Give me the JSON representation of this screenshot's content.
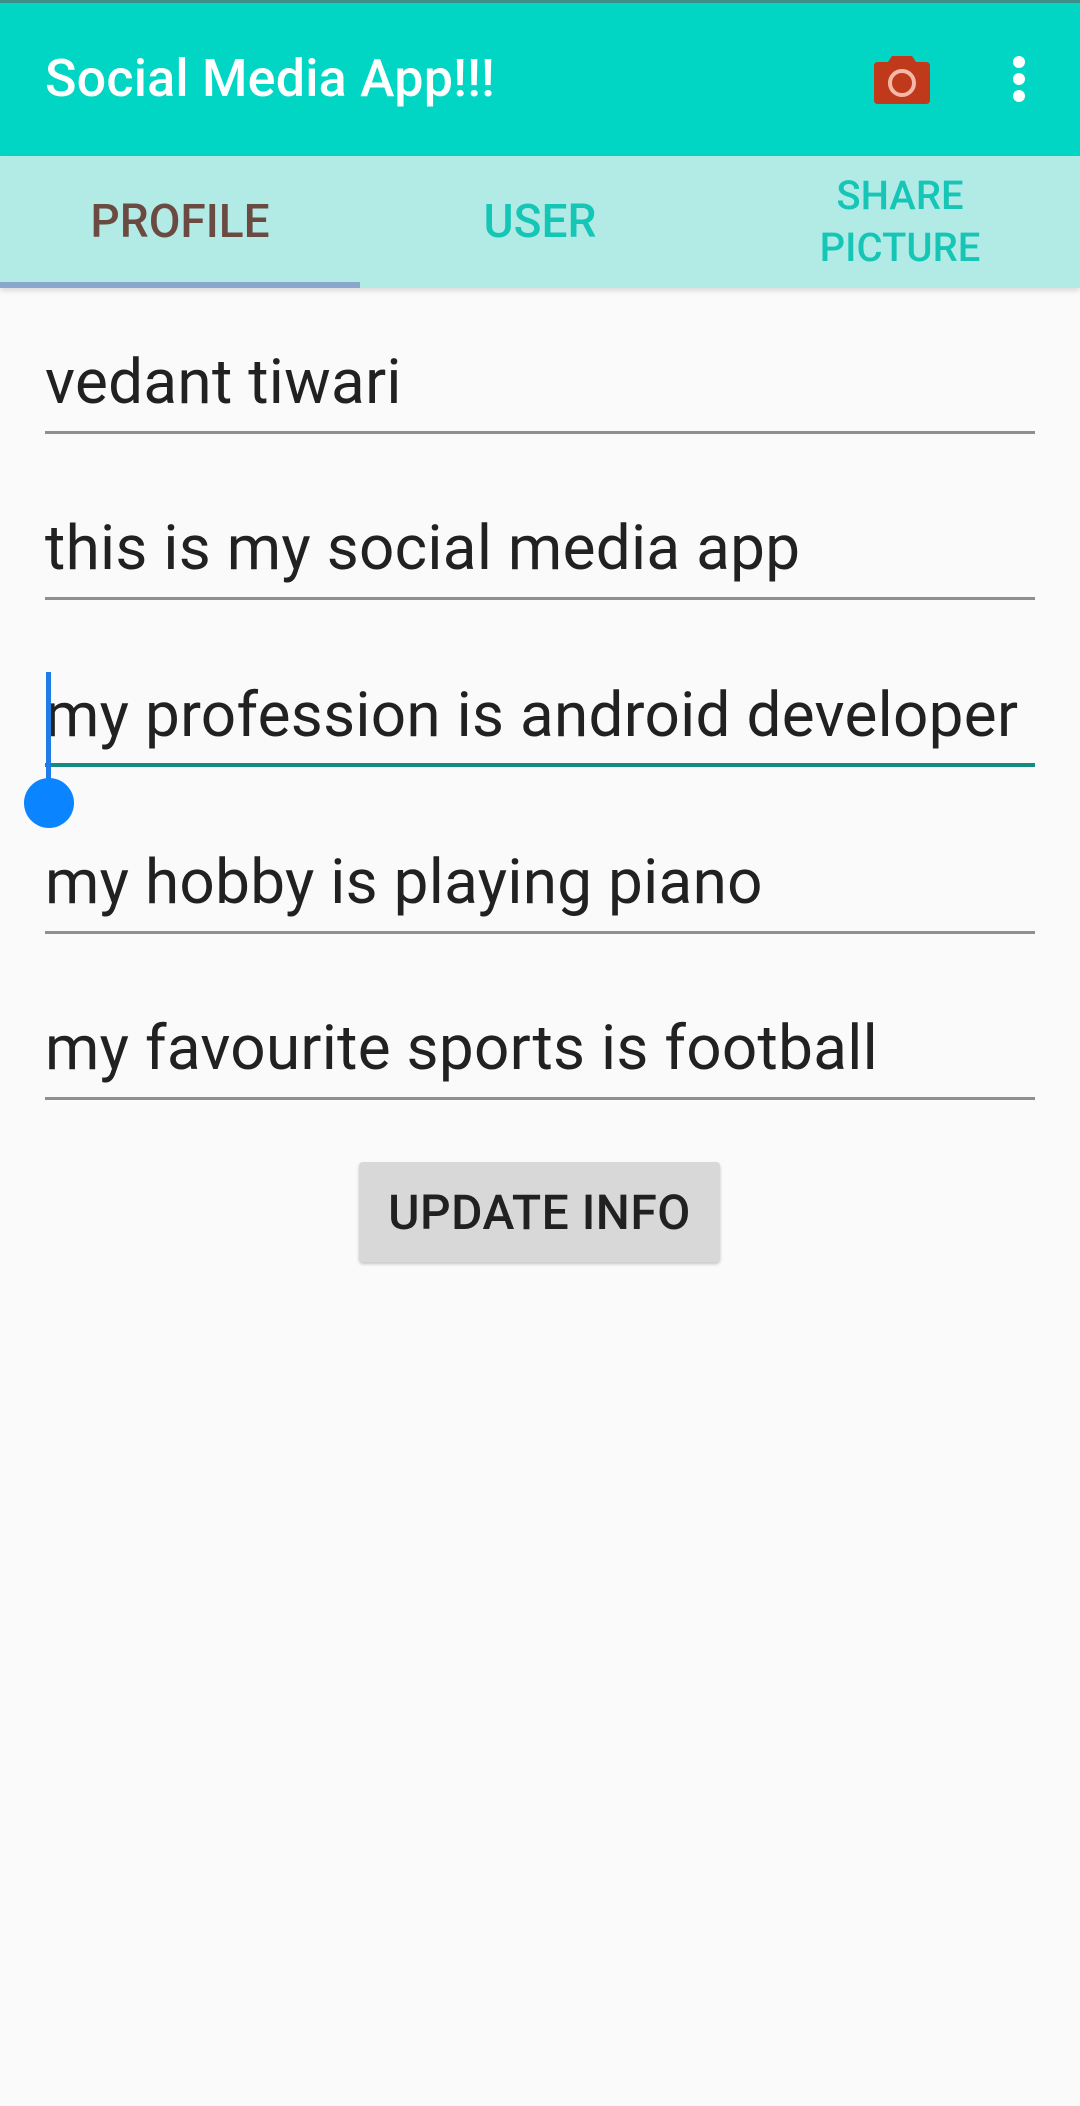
{
  "app_bar": {
    "title": "Social Media App!!!",
    "camera_icon": "camera-icon",
    "overflow_icon": "more-vert-icon",
    "background_color": "#00d6c3",
    "camera_icon_color": "#c0391b"
  },
  "tabs": [
    {
      "label": "PROFILE",
      "selected": true
    },
    {
      "label": "USER",
      "selected": false
    },
    {
      "label": "SHARE\nPICTURE",
      "selected": false
    }
  ],
  "profile_form": {
    "fields": [
      {
        "value": "vedant tiwari"
      },
      {
        "value": "this is my social media app"
      },
      {
        "value": "my profession is android developer"
      },
      {
        "value": "my hobby is playing piano"
      },
      {
        "value": "my favourite sports is football"
      }
    ],
    "update_button_label": "UPDATE INFO"
  }
}
